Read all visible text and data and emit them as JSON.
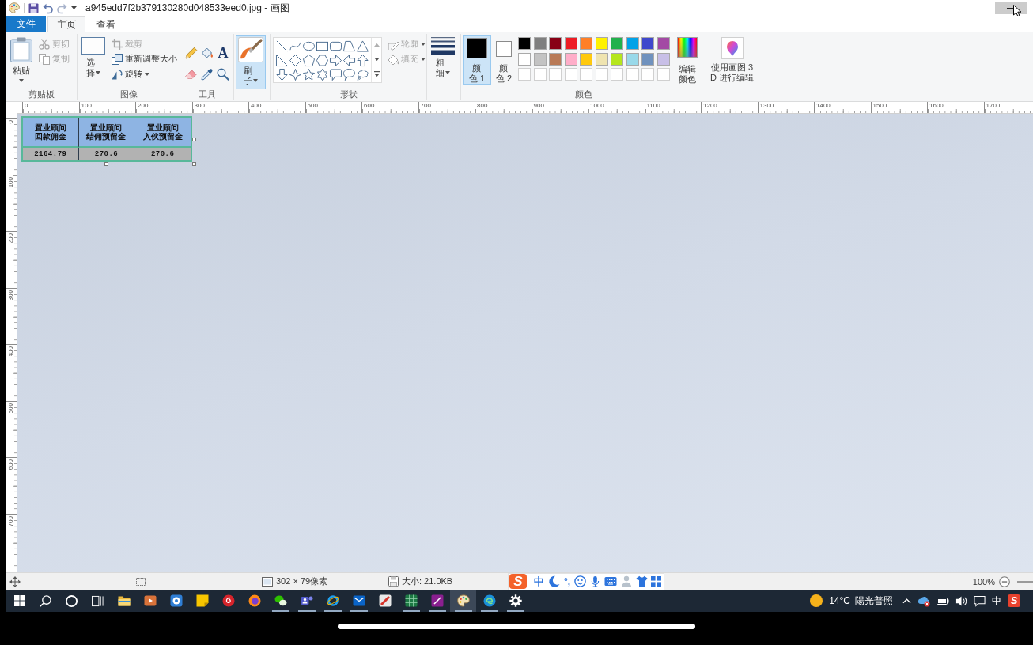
{
  "window": {
    "title": "a945edd7f2b379130280d048533eed0.jpg - 画图",
    "minimize_button": {
      "hovered": true
    }
  },
  "tabs": [
    {
      "label": "文件",
      "kind": "menu",
      "selected": false
    },
    {
      "label": "主页",
      "kind": "tab",
      "selected": true
    },
    {
      "label": "查看",
      "kind": "tab",
      "selected": false
    }
  ],
  "ribbon": {
    "groups": [
      {
        "kind": "clipboard",
        "label": "剪贴板",
        "button": {
          "label": "粘贴"
        },
        "items": [
          {
            "label": "剪切",
            "disabled": true
          },
          {
            "label": "复制",
            "disabled": true
          }
        ]
      },
      {
        "kind": "image",
        "label": "图像",
        "button": {
          "label": "选择"
        },
        "items": [
          {
            "label": "裁剪",
            "disabled": true
          },
          {
            "label": "重新调整大小",
            "disabled": false
          },
          {
            "label": "旋转",
            "disabled": false
          }
        ]
      },
      {
        "kind": "tools",
        "label": "工具",
        "text_tool": "A"
      },
      {
        "kind": "brushes",
        "button": {
          "label": "刷子",
          "selected": true
        }
      },
      {
        "kind": "shapes",
        "label": "形状",
        "items": [
          {
            "label": "轮廓",
            "disabled": true
          },
          {
            "label": "填充",
            "disabled": true
          }
        ]
      },
      {
        "kind": "size",
        "button": {
          "label": "粗细"
        }
      },
      {
        "kind": "colors",
        "label": "颜色",
        "slots": [
          {
            "label": "颜色 1",
            "color": "#000000",
            "selected": true
          },
          {
            "label": "颜色 2",
            "color": "#ffffff",
            "selected": false
          }
        ],
        "palette": [
          {
            "color": "#000000"
          },
          {
            "color": "#7f7f7f"
          },
          {
            "color": "#880015"
          },
          {
            "color": "#ed1c24"
          },
          {
            "color": "#ff7f27"
          },
          {
            "color": "#fff200"
          },
          {
            "color": "#22b14c"
          },
          {
            "color": "#00a2e8"
          },
          {
            "color": "#3f48cc"
          },
          {
            "color": "#a349a4"
          },
          {
            "color": "#ffffff"
          },
          {
            "color": "#c3c3c3"
          },
          {
            "color": "#b97a57"
          },
          {
            "color": "#ffaec9"
          },
          {
            "color": "#ffc90e"
          },
          {
            "color": "#efe4b0"
          },
          {
            "color": "#b5e61d"
          },
          {
            "color": "#99d9ea"
          },
          {
            "color": "#7092be"
          },
          {
            "color": "#c8bfe7"
          }
        ],
        "button": {
          "label": "编辑颜色"
        }
      },
      {
        "kind": "paint3d",
        "button": {
          "label": "使用画图 3\nD 进行编辑"
        }
      }
    ]
  },
  "rulers": {
    "horizontal": [
      "0",
      "100",
      "200",
      "300",
      "400",
      "500",
      "600",
      "700",
      "800",
      "900",
      "1000",
      "1100",
      "1200",
      "1300",
      "1400",
      "1500",
      "1600",
      "1700"
    ],
    "vertical": [
      "0",
      "100",
      "200",
      "300",
      "400",
      "500",
      "600",
      "700"
    ]
  },
  "canvas": {
    "image": {
      "columns": [
        {
          "header": [
            "置业顾问",
            "回款佣金"
          ],
          "value": "2164.79"
        },
        {
          "header": [
            "置业顾问",
            "结佣预留金"
          ],
          "value": "270.6"
        },
        {
          "header": [
            "置业顾问",
            "入伙预留金"
          ],
          "value": "270.6"
        }
      ]
    }
  },
  "status_bar": {
    "selection_size": "302 × 79像素",
    "file_size": "大小: 21.0KB",
    "zoom": "100%"
  },
  "ime_toolbar": {
    "logo": "S",
    "mode": "中",
    "punctuation": "°,"
  },
  "taskbar": {
    "apps": [
      {
        "running": false,
        "active": false
      },
      {
        "running": false,
        "active": false
      },
      {
        "running": false,
        "active": false
      },
      {
        "running": false,
        "active": false
      },
      {
        "running": false,
        "active": false
      },
      {
        "running": false,
        "active": false
      },
      {
        "running": true,
        "active": false
      },
      {
        "running": true,
        "active": false
      },
      {
        "running": true,
        "active": false
      },
      {
        "running": true,
        "active": false
      },
      {
        "running": false,
        "active": false
      },
      {
        "running": true,
        "active": false
      },
      {
        "running": true,
        "active": false
      },
      {
        "running": true,
        "active": true
      },
      {
        "running": true,
        "active": false
      },
      {
        "running": true,
        "active": false
      }
    ],
    "weather": {
      "temperature": "14°C",
      "condition": "陽光普照"
    },
    "input_mode": "中",
    "ime_logo": "S"
  }
}
